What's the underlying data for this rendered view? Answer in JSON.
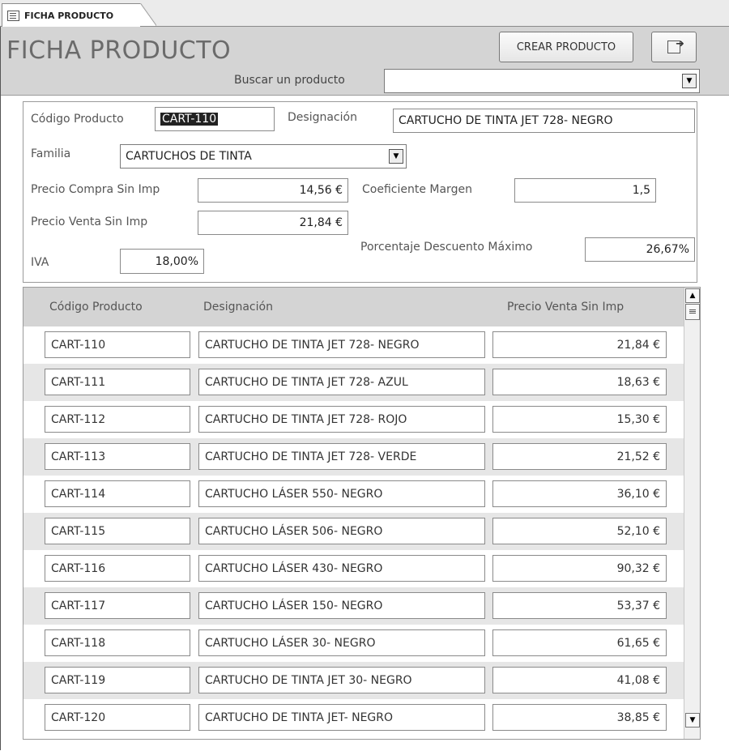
{
  "tab": {
    "label": "FICHA PRODUCTO"
  },
  "header": {
    "title": "FICHA PRODUCTO",
    "create_button": "CREAR PRODUCTO",
    "search_label": "Buscar un producto",
    "search_value": ""
  },
  "detail": {
    "code_label": "Código Producto",
    "code_value": "CART-110",
    "designation_label": "Designación",
    "designation_value": "CARTUCHO DE TINTA JET 728- NEGRO",
    "family_label": "Familia",
    "family_value": "CARTUCHOS DE TINTA",
    "purchase_price_label": "Precio Compra Sin Imp",
    "purchase_price_value": "14,56 €",
    "margin_label": "Coeficiente Margen",
    "margin_value": "1,5",
    "sale_price_label": "Precio Venta Sin Imp",
    "sale_price_value": "21,84 €",
    "discount_label": "Porcentaje Descuento Máximo",
    "discount_value": "26,67%",
    "vat_label": "IVA",
    "vat_value": "18,00%"
  },
  "list": {
    "headers": [
      "Código Producto",
      "Designación",
      "Precio Venta Sin Imp"
    ],
    "rows": [
      [
        "CART-110",
        "CARTUCHO DE TINTA JET 728- NEGRO",
        "21,84 €"
      ],
      [
        "CART-111",
        "CARTUCHO DE TINTA JET  728- AZUL",
        "18,63 €"
      ],
      [
        "CART-112",
        "CARTUCHO DE TINTA JET  728- ROJO",
        "15,30 €"
      ],
      [
        "CART-113",
        "CARTUCHO DE TINTA JET  728- VERDE",
        "21,52 €"
      ],
      [
        "CART-114",
        "CARTUCHO LÁSER 550- NEGRO",
        "36,10 €"
      ],
      [
        "CART-115",
        "CARTUCHO LÁSER 506- NEGRO",
        "52,10 €"
      ],
      [
        "CART-116",
        "CARTUCHO LÁSER 430- NEGRO",
        "90,32 €"
      ],
      [
        "CART-117",
        "CARTUCHO LÁSER 150- NEGRO",
        "53,37 €"
      ],
      [
        "CART-118",
        "CARTUCHO LÁSER 30- NEGRO",
        "61,65 €"
      ],
      [
        "CART-119",
        "CARTUCHO DE TINTA JET 30- NEGRO",
        "41,08 €"
      ],
      [
        "CART-120",
        "CARTUCHO DE TINTA JET- NEGRO",
        "38,85 €"
      ]
    ]
  },
  "icons": {
    "tab": "form-icon",
    "exit": "exit-door-icon",
    "dropdown": "dropdown-arrow-icon",
    "scroll_up": "scroll-up-icon",
    "scroll_down": "scroll-down-icon"
  }
}
